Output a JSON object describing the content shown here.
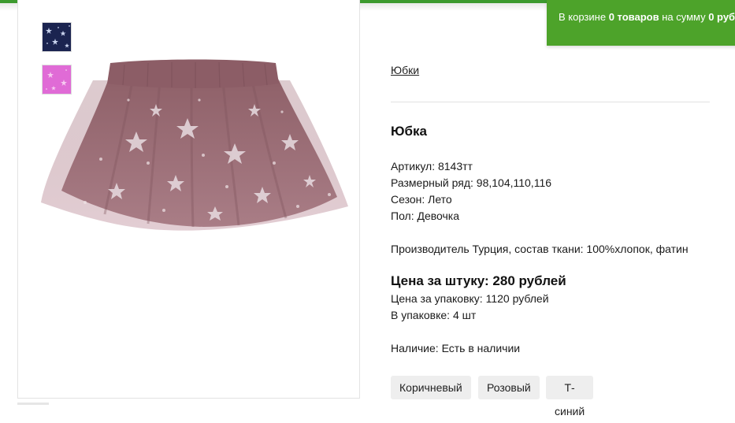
{
  "cart": {
    "prefix": "В корзине ",
    "count_text": "0 товаров",
    "middle": " на сумму ",
    "sum_text": "0 руб"
  },
  "breadcrumb": {
    "category": "Юбки"
  },
  "product": {
    "title": "Юбка",
    "article": "Артикул: 8143тт",
    "sizes": "Размерный ряд: 98,104,110,116",
    "season": "Сезон: Лето",
    "gender": "Пол: Девочка",
    "manufacturer": "Производитель Турция, состав ткани: 100%хлопок, фатин",
    "price_unit": "Цена за штуку: 280 рублей",
    "price_pack": "Цена за упаковку: 1120 рублей",
    "pack_qty": "В упаковке: 4 шт",
    "availability": "Наличие: Есть в наличии"
  },
  "colors": [
    "Коричневый",
    "Розовый",
    "Т-синий"
  ],
  "thumbnails": [
    {
      "color": "#1b2450",
      "name": "navy-skirt"
    },
    {
      "color": "#e06bd6",
      "name": "pink-skirt"
    }
  ],
  "accent": {
    "cart_green": "#4da32a",
    "top_strip": "#3d9a2f",
    "skirt": "#9a6b72"
  }
}
